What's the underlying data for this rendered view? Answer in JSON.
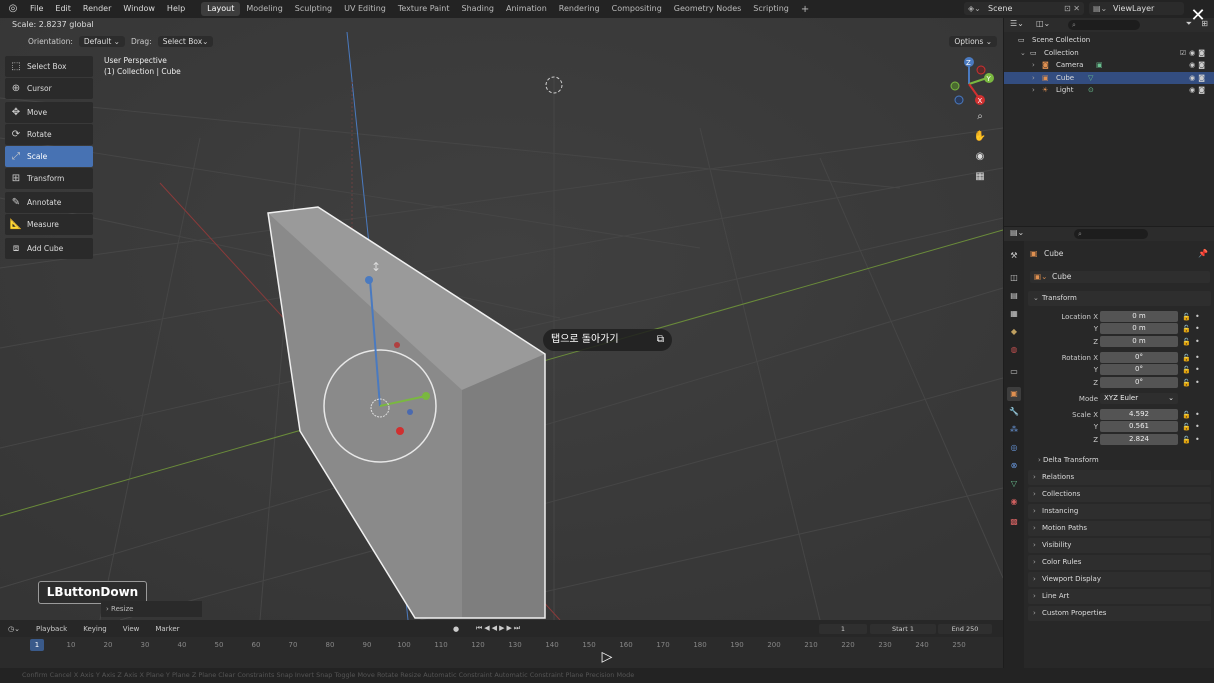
{
  "menu": [
    "File",
    "Edit",
    "Render",
    "Window",
    "Help"
  ],
  "workspaces": [
    "Layout",
    "Modeling",
    "Sculpting",
    "UV Editing",
    "Texture Paint",
    "Shading",
    "Animation",
    "Rendering",
    "Compositing",
    "Geometry Nodes",
    "Scripting"
  ],
  "active_workspace": "Layout",
  "scene": "Scene",
  "view_layer": "ViewLayer",
  "status_text": "Scale: 2.8237 global",
  "header": {
    "orientation_label": "Orientation:",
    "orientation_value": "Default",
    "drag_label": "Drag:",
    "drag_value": "Select Box",
    "options": "Options"
  },
  "tools": [
    {
      "label": "Select Box",
      "icon": "select-box-icon"
    },
    {
      "label": "Cursor",
      "icon": "cursor-icon"
    },
    {
      "label": "Move",
      "icon": "move-icon"
    },
    {
      "label": "Rotate",
      "icon": "rotate-icon"
    },
    {
      "label": "Scale",
      "icon": "scale-icon",
      "active": true
    },
    {
      "label": "Transform",
      "icon": "transform-icon"
    },
    {
      "label": "Annotate",
      "icon": "annotate-icon"
    },
    {
      "label": "Measure",
      "icon": "measure-icon"
    },
    {
      "label": "Add Cube",
      "icon": "add-cube-icon"
    }
  ],
  "viewport_info": {
    "view": "User Perspective",
    "collection": "(1) Collection | Cube"
  },
  "overlay_tooltip": "탭으로 돌아가기",
  "lbutton": "LButtonDown",
  "resize_panel": "Resize",
  "timeline": {
    "menu": [
      "Playback",
      "Keying",
      "View",
      "Marker"
    ],
    "current_frame": "1",
    "start_label": "Start",
    "start": "1",
    "end_label": "End",
    "end": "250",
    "ticks": [
      "10",
      "20",
      "30",
      "40",
      "50",
      "60",
      "70",
      "80",
      "90",
      "100",
      "110",
      "120",
      "130",
      "140",
      "150",
      "160",
      "170",
      "180",
      "190",
      "200",
      "210",
      "220",
      "230",
      "240",
      "250"
    ],
    "first_tick": "1"
  },
  "status_bar": "Confirm   Cancel   X Axis   Y Axis   Z Axis   X Plane   Y Plane   Z Plane   Clear Constraints   Snap Invert   Snap Toggle   Move   Rotate   Resize   Automatic Constraint   Automatic Constraint Plane   Precision Mode",
  "outliner": {
    "rows": [
      {
        "label": "Scene Collection",
        "indent": 0
      },
      {
        "label": "Collection",
        "indent": 1
      },
      {
        "label": "Camera",
        "indent": 2
      },
      {
        "label": "Cube",
        "indent": 2,
        "selected": true
      },
      {
        "label": "Light",
        "indent": 2
      }
    ]
  },
  "properties": {
    "object": "Cube",
    "object_name": "Cube",
    "transform_header": "Transform",
    "location": {
      "label": "Location X",
      "x": "0 m",
      "y": "0 m",
      "z": "0 m"
    },
    "rotation": {
      "label": "Rotation X",
      "x": "0°",
      "y": "0°",
      "z": "0°"
    },
    "mode_label": "Mode",
    "mode_value": "XYZ Euler",
    "scale": {
      "label": "Scale X",
      "x": "4.592",
      "y": "0.561",
      "z": "2.824"
    },
    "y_label": "Y",
    "z_label": "Z",
    "delta": "Delta Transform",
    "sections": [
      "Relations",
      "Collections",
      "Instancing",
      "Motion Paths",
      "Visibility",
      "Color Rules",
      "Viewport Display",
      "Line Art",
      "Custom Properties"
    ]
  }
}
